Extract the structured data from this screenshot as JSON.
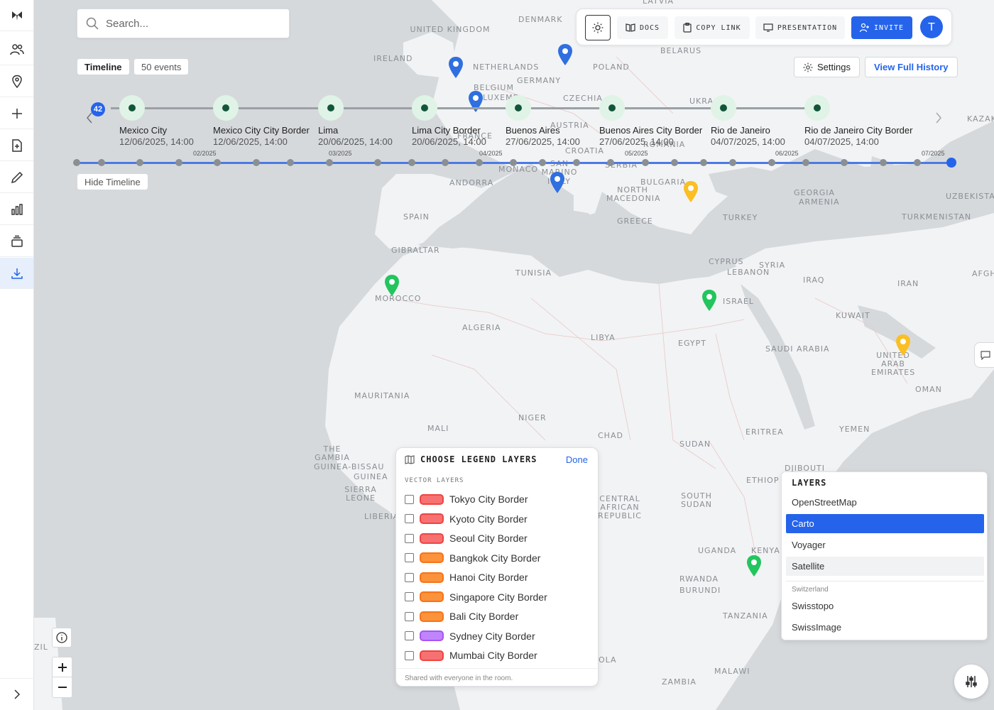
{
  "search": {
    "placeholder": "Search..."
  },
  "toolbar": {
    "docs": "DOCS",
    "copy_link": "COPY LINK",
    "presentation": "PRESENTATION",
    "invite": "INVITE",
    "avatar_initial": "T"
  },
  "timeline": {
    "label": "Timeline",
    "events_count": "50 events",
    "hide": "Hide Timeline",
    "badge": "42",
    "events": [
      {
        "name": "Mexico City",
        "date": "12/06/2025, 14:00"
      },
      {
        "name": "Mexico City City Border",
        "date": "12/06/2025, 14:00"
      },
      {
        "name": "Lima",
        "date": "20/06/2025, 14:00"
      },
      {
        "name": "Lima City Border",
        "date": "20/06/2025, 14:00"
      },
      {
        "name": "Buenos Aires",
        "date": "27/06/2025, 14:00"
      },
      {
        "name": "Buenos Aires City Border",
        "date": "27/06/2025, 14:00"
      },
      {
        "name": "Rio de Janeiro",
        "date": "04/07/2025, 14:00"
      },
      {
        "name": "Rio de Janeiro City Border",
        "date": "04/07/2025, 14:00"
      }
    ],
    "axis_labels": [
      "02/2025",
      "03/2025",
      "04/2025",
      "05/2025",
      "06/2025",
      "07/2025"
    ]
  },
  "top_right": {
    "settings": "Settings",
    "history": "View Full History"
  },
  "map_labels": {
    "latvia": "LATVIA",
    "denmark": "DENMARK",
    "uk": "UNITED KINGDOM",
    "ireland": "IRELAND",
    "netherlands": "NETHERLANDS",
    "belarus": "BELARUS",
    "poland": "POLAND",
    "germany": "GERMANY",
    "belgium": "BELGIUM",
    "luxemb": "LUXEMB",
    "czechia": "CZECHIA",
    "ukraine": "UKRA",
    "france": "FRANCE",
    "austria": "AUSTRIA",
    "kazak": "KAZAK",
    "croatia": "CROATIA",
    "monaco": "MONACO",
    "san_marino": "SAN MARINO",
    "italy": "ITALY",
    "serbia": "SERBIA",
    "romania": "ROMANIA",
    "andorra": "ANDORRA",
    "bulgaria": "BULGARIA",
    "north_macedonia": "NORTH MACEDONIA",
    "georgia": "GEORGIA",
    "armenia": "ARMENIA",
    "uzbekistan": "UZBEKISTA",
    "spain": "SPAIN",
    "turkey": "TURKEY",
    "turkmenistan": "TURKMENISTAN",
    "greece": "GREECE",
    "gibraltar": "GIBRALTAR",
    "tunisia": "TUNISIA",
    "cyprus": "CYPRUS",
    "syria": "SYRIA",
    "lebanon": "LEBANON",
    "afghan": "AFGHAN",
    "morocco": "MOROCCO",
    "iraq": "IRAQ",
    "iran": "IRAN",
    "israel": "ISRAEL",
    "kuwait": "KUWAIT",
    "algeria": "ALGERIA",
    "libya": "LIBYA",
    "egypt": "EGYPT",
    "saudi": "SAUDI ARABIA",
    "uae": "UNITED ARAB EMIRATES",
    "oman": "OMAN",
    "mauritania": "MAURITANIA",
    "niger": "NIGER",
    "mali": "MALI",
    "chad": "CHAD",
    "sudan": "SUDAN",
    "eritrea": "ERITREA",
    "yemen": "YEMEN",
    "gambia": "THE GAMBIA",
    "guinea_bissau": "GUINEA-BISSAU",
    "guinea": "GUINEA",
    "djibouti": "DJIBOUTI",
    "ethiop": "ETHIOP",
    "sierra": "SIERRA LEONE",
    "liberia": "LIBERIA",
    "car": "CENTRAL AFRICAN REPUBLIC",
    "south_sudan": "SOUTH SUDAN",
    "uganda": "UGANDA",
    "kenya": "KENYA",
    "rwanda": "RWANDA",
    "burundi": "BURUNDI",
    "tanzania": "TANZANIA",
    "angola": "OLA",
    "malawi": "MALAWI",
    "zambia": "ZAMBIA",
    "brazil": "ZIL"
  },
  "legend": {
    "title": "CHOOSE LEGEND LAYERS",
    "done": "Done",
    "subtitle": "VECTOR LAYERS",
    "items": [
      {
        "label": "Tokyo City Border",
        "fill": "#f87171",
        "stroke": "#ef4444"
      },
      {
        "label": "Kyoto City Border",
        "fill": "#f87171",
        "stroke": "#ef4444"
      },
      {
        "label": "Seoul City Border",
        "fill": "#f87171",
        "stroke": "#ef4444"
      },
      {
        "label": "Bangkok City Border",
        "fill": "#fb923c",
        "stroke": "#f97316"
      },
      {
        "label": "Hanoi City Border",
        "fill": "#fb923c",
        "stroke": "#f97316"
      },
      {
        "label": "Singapore City Border",
        "fill": "#fb923c",
        "stroke": "#f97316"
      },
      {
        "label": "Bali City Border",
        "fill": "#fb923c",
        "stroke": "#f97316"
      },
      {
        "label": "Sydney City Border",
        "fill": "#c084fc",
        "stroke": "#a855f7"
      },
      {
        "label": "Mumbai City Border",
        "fill": "#f87171",
        "stroke": "#ef4444"
      }
    ],
    "footer": "Shared with everyone in the room."
  },
  "layers": {
    "title": "LAYERS",
    "items": [
      "OpenStreetMap",
      "Carto",
      "Voyager",
      "Satellite"
    ],
    "selected": "Carto",
    "group": "Switzerland",
    "group_items": [
      "Swisstopo",
      "SwissImage"
    ]
  },
  "colors": {
    "accent": "#2563eb",
    "pin_blue": "#2f6fe0",
    "pin_green": "#22c55e",
    "pin_yellow": "#fbbf24"
  }
}
